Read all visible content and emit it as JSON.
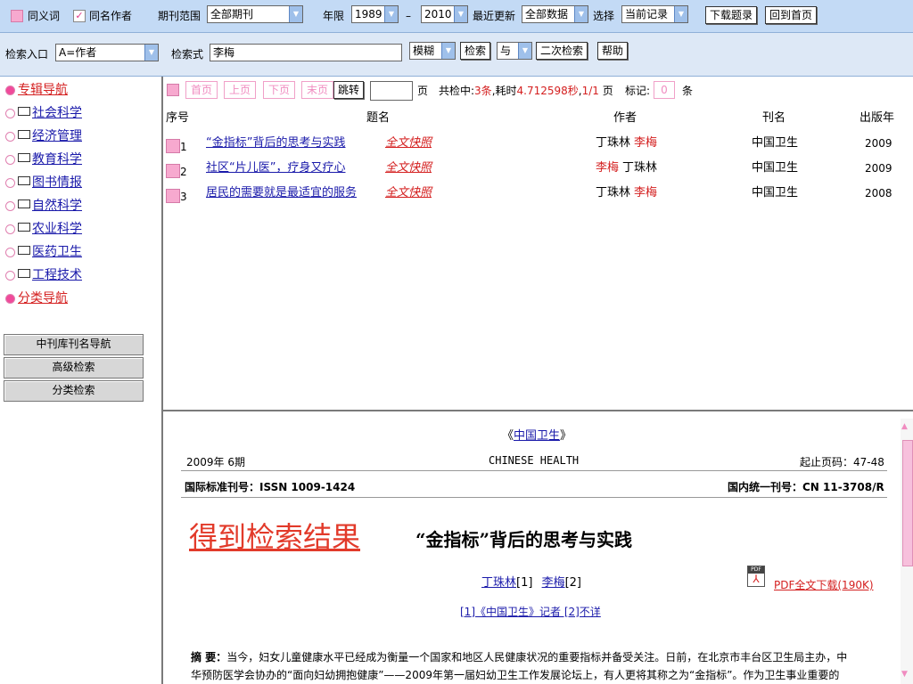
{
  "topbar": {
    "synonym_label": "同义词",
    "same_author_label": "同名作者",
    "journal_scope_label": "期刊范围",
    "journal_scope_value": "全部期刊",
    "year_label": "年限",
    "year_from": "1989",
    "year_dash": "–",
    "year_to": "2010",
    "update_label": "最近更新",
    "update_value": "全部数据",
    "select_label": "选择",
    "select_value": "当前记录",
    "download_button": "下载题录",
    "home_button": "回到首页"
  },
  "searchbar": {
    "entry_label": "检索入口",
    "entry_value": "A=作者",
    "query_label": "检索式",
    "query_value": "李梅",
    "match_value": "模糊",
    "search_button": "检索",
    "logic_value": "与",
    "secondary_button": "二次检索",
    "help_button": "帮助"
  },
  "sidebar": {
    "items": [
      {
        "label": "专辑导航",
        "type": "section"
      },
      {
        "label": "社会科学",
        "type": "folder"
      },
      {
        "label": "经济管理",
        "type": "folder"
      },
      {
        "label": "教育科学",
        "type": "folder"
      },
      {
        "label": "图书情报",
        "type": "folder"
      },
      {
        "label": "自然科学",
        "type": "folder"
      },
      {
        "label": "农业科学",
        "type": "folder"
      },
      {
        "label": "医药卫生",
        "type": "folder"
      },
      {
        "label": "工程技术",
        "type": "folder"
      },
      {
        "label": "分类导航",
        "type": "section"
      }
    ],
    "buttons": [
      "中刊库刊名导航",
      "高级检索",
      "分类检索"
    ]
  },
  "pager": {
    "first": "首页",
    "prev": "上页",
    "next": "下页",
    "last": "末页",
    "jump": "跳转",
    "page_input": "",
    "page_unit": "页",
    "summary_prefix": "共检中:",
    "summary_count": "3条",
    "summary_time_label": ",耗时",
    "summary_time": "4.712598秒",
    "summary_pages": "1/1",
    "summary_page_unit": "页",
    "mark_label": "标记:",
    "mark_value": "0",
    "mark_unit": "条"
  },
  "table": {
    "headers": {
      "num": "序号",
      "title": "题名",
      "author": "作者",
      "journal": "刊名",
      "year": "出版年"
    },
    "full_text_label": "全文快照",
    "rows": [
      {
        "num": "1",
        "title": "“金指标”背后的思考与实践",
        "authors": [
          {
            "name": "丁珠林",
            "highlight": false
          },
          {
            "name": "李梅",
            "highlight": true
          }
        ],
        "journal": "中国卫生",
        "year": "2009"
      },
      {
        "num": "2",
        "title": "社区“片儿医”，疗身又疗心",
        "authors": [
          {
            "name": "李梅",
            "highlight": true
          },
          {
            "name": "丁珠林",
            "highlight": false
          }
        ],
        "journal": "中国卫生",
        "year": "2009"
      },
      {
        "num": "3",
        "title": "居民的需要就是最适宜的服务",
        "authors": [
          {
            "name": "丁珠林",
            "highlight": false
          },
          {
            "name": "李梅",
            "highlight": true
          }
        ],
        "journal": "中国卫生",
        "year": "2008"
      }
    ]
  },
  "detail": {
    "journal_open": "《",
    "journal_name": "中国卫生",
    "journal_close": "》",
    "issue": "2009年 6期",
    "english_name": "CHINESE HEALTH",
    "pages": "起止页码：47-48",
    "issn": "国际标准刊号：ISSN 1009-1424",
    "cn": "国内统一刊号：CN 11-3708/R",
    "result_label": "得到检索结果",
    "article_title": "“金指标”背后的思考与实践",
    "author1": "丁珠林",
    "author1_ref": "[1]",
    "author2": "李梅",
    "author2_ref": "[2]",
    "pdf_icon_text": "PDF",
    "pdf_link": "PDF全文下载(190K)",
    "affiliation": "[1]《中国卫生》记者 [2]不详",
    "abstract_label": "摘  要：",
    "abstract_line1": "当今，妇女儿童健康水平已经成为衡量一个国家和地区人民健康状况的重要指标并备受关注。日前，在北京市丰台区卫生局主办，中",
    "abstract_line2": "华预防医学会协办的“面向妇幼拥抱健康”——2009年第一届妇幼卫生工作发展论坛上，有人更将其称之为“金指标”。作为卫生事业重要的"
  },
  "colors": {
    "accent_pink": "#f04a9a",
    "link_blue": "#1a1aaa",
    "highlight_red": "#d42020",
    "bar_blue": "#c3daf5"
  }
}
